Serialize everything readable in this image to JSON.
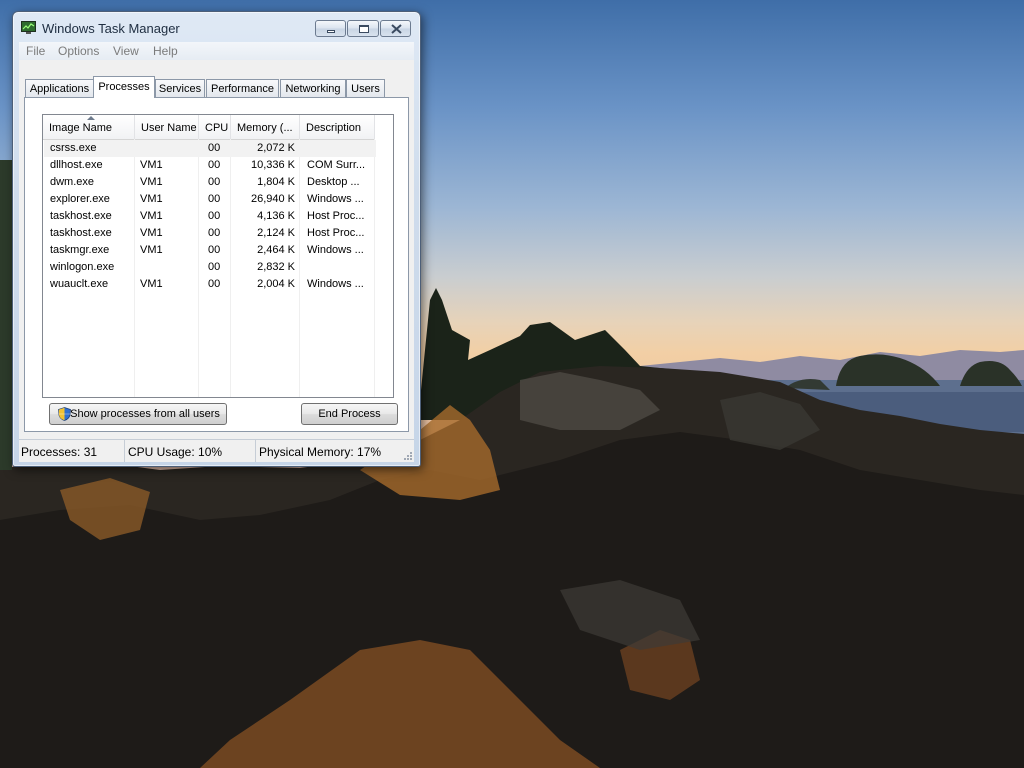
{
  "window": {
    "title": "Windows Task Manager"
  },
  "menu": [
    "File",
    "Options",
    "View",
    "Help"
  ],
  "tabs": [
    {
      "label": "Applications",
      "active": false
    },
    {
      "label": "Processes",
      "active": true
    },
    {
      "label": "Services",
      "active": false
    },
    {
      "label": "Performance",
      "active": false
    },
    {
      "label": "Networking",
      "active": false
    },
    {
      "label": "Users",
      "active": false
    }
  ],
  "columns": [
    "Image Name",
    "User Name",
    "CPU",
    "Memory (...",
    "Description"
  ],
  "processes": [
    {
      "name": "csrss.exe",
      "user": "",
      "cpu": "00",
      "memory": "2,072 K",
      "description": ""
    },
    {
      "name": "dllhost.exe",
      "user": "VM1",
      "cpu": "00",
      "memory": "10,336 K",
      "description": "COM Surr..."
    },
    {
      "name": "dwm.exe",
      "user": "VM1",
      "cpu": "00",
      "memory": "1,804 K",
      "description": "Desktop ..."
    },
    {
      "name": "explorer.exe",
      "user": "VM1",
      "cpu": "00",
      "memory": "26,940 K",
      "description": "Windows ..."
    },
    {
      "name": "taskhost.exe",
      "user": "VM1",
      "cpu": "00",
      "memory": "4,136 K",
      "description": "Host Proc..."
    },
    {
      "name": "taskhost.exe",
      "user": "VM1",
      "cpu": "00",
      "memory": "2,124 K",
      "description": "Host Proc..."
    },
    {
      "name": "taskmgr.exe",
      "user": "VM1",
      "cpu": "00",
      "memory": "2,464 K",
      "description": "Windows ..."
    },
    {
      "name": "winlogon.exe",
      "user": "",
      "cpu": "00",
      "memory": "2,832 K",
      "description": ""
    },
    {
      "name": "wuauclt.exe",
      "user": "VM1",
      "cpu": "00",
      "memory": "2,004 K",
      "description": "Windows ..."
    }
  ],
  "buttons": {
    "show_all": "Show processes from all users",
    "end_process": "End Process"
  },
  "status": {
    "processes": "Processes: 31",
    "cpu": "CPU Usage: 10%",
    "memory": "Physical Memory: 17%"
  },
  "icons": {
    "app": "task-manager-icon",
    "shield": "uac-shield-icon",
    "sort": "sort-ascending-icon",
    "resize": "resize-grip-icon"
  }
}
